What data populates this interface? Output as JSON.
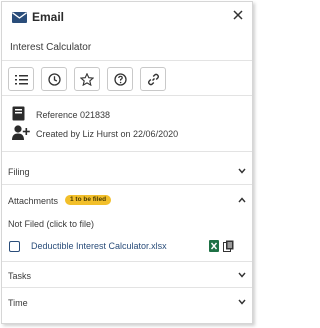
{
  "header": {
    "title": "Email",
    "close_icon": "close-icon",
    "mail_icon": "envelope-icon"
  },
  "subject": "Interest Calculator",
  "toolbar": {
    "icons": [
      "checklist-icon",
      "clock-icon",
      "star-icon",
      "help-icon",
      "link-icon"
    ]
  },
  "meta": {
    "reference_label": "Reference",
    "reference_value": "021838",
    "created_text": "Created by Liz Hurst on 22/06/2020"
  },
  "sections": {
    "filing": "Filing",
    "attachments": "Attachments",
    "attachments_badge": "1 to be filed",
    "not_filed": "Not Filed (click to file)",
    "tasks": "Tasks",
    "time": "Time"
  },
  "attachment": {
    "name": "Deductible Interest Calculator.xlsx",
    "file_type_icon": "excel-icon"
  },
  "colors": {
    "accent": "#2a4d7a",
    "badge": "#f2bf2a",
    "excel": "#1e7145",
    "border": "#d6d6d6"
  }
}
